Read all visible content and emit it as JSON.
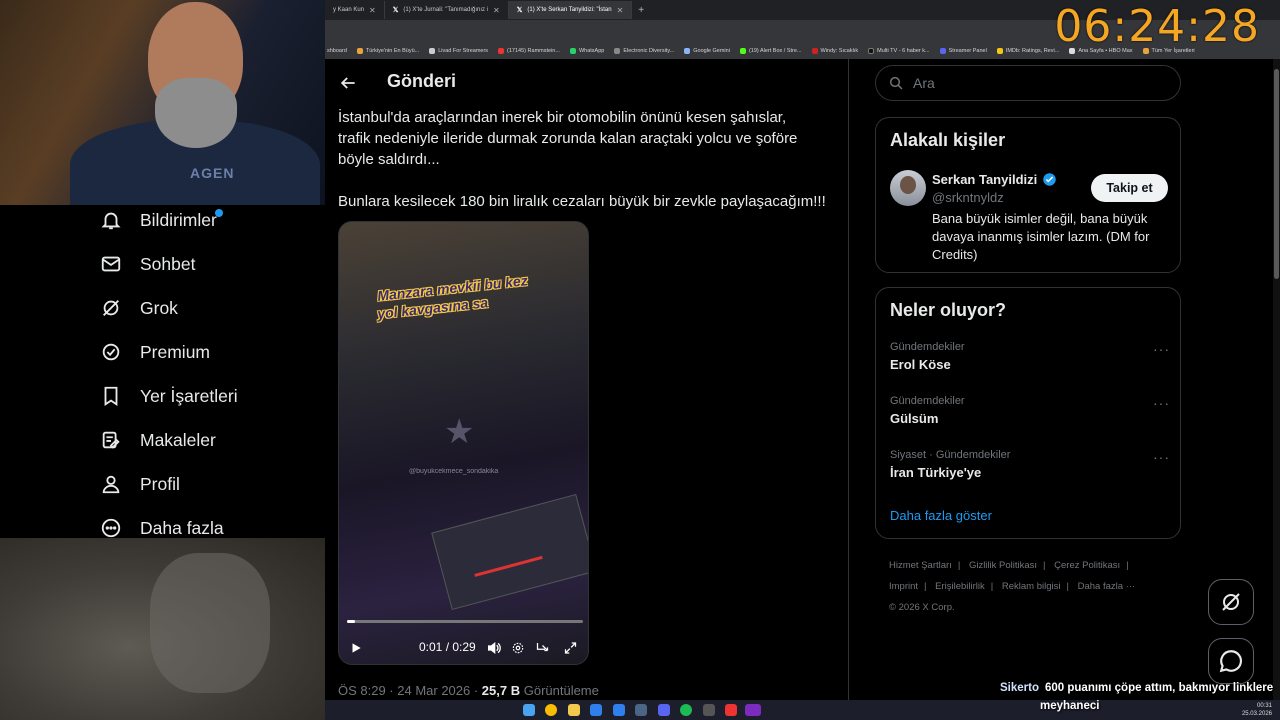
{
  "clock": "06:24:28",
  "browser": {
    "tabs": [
      {
        "label": "y Kaan Kun"
      },
      {
        "label": "(1) X'te Jurnali: \"Tanımadığınız i"
      },
      {
        "label": "(1) X'te Serkan Tanyildizi: \"İstan"
      }
    ],
    "bookmarks": [
      "shboard",
      "Türkiye'nin En Büyü...",
      "Livad For Streamers",
      "(17145) Rammstein...",
      "WhatsApp",
      "Electronic Diversity...",
      "Google Gemini",
      "(19) Alert Box / Stre...",
      "Windy: Sıcaklık",
      "Multi TV - 6 haber k...",
      "Streamer Panel",
      "IMDb: Ratings, Revi...",
      "Ana Sayfa • HBO Max",
      "Tüm Yer İşaretleri"
    ]
  },
  "nav": {
    "items": [
      {
        "label": "Bildirimler",
        "icon": "bell-icon"
      },
      {
        "label": "Sohbet",
        "icon": "mail-icon"
      },
      {
        "label": "Grok",
        "icon": "grok-icon"
      },
      {
        "label": "Premium",
        "icon": "premium-icon"
      },
      {
        "label": "Yer İşaretleri",
        "icon": "bookmark-icon"
      },
      {
        "label": "Makaleler",
        "icon": "article-icon"
      },
      {
        "label": "Profil",
        "icon": "profile-icon"
      },
      {
        "label": "Daha fazla",
        "icon": "more-icon"
      }
    ]
  },
  "webcam": {
    "shirt_text": "AGEN"
  },
  "post": {
    "header": "Gönderi",
    "lines": [
      "İstanbul'da araçlarından inerek bir otomobilin önünü kesen şahıslar,",
      "trafik nedeniyle ileride durmak zorunda kalan araçtaki yolcu ve şoföre",
      "böyle saldırdı...",
      "Bunlara kesilecek 180 bin liralık cezaları büyük bir zevkle paylaşacağım!!!"
    ],
    "video": {
      "caption1": "Manzara mevkii bu kez",
      "caption2": "yol kavgasına sa",
      "watermark": "@buyukcekmece_sondakika",
      "time": "0:01 / 0:29",
      "progress": 0.034
    },
    "meta_time": "ÖS 8:29 · 24 Mar 2026 · ",
    "views": "25,7 B",
    "views_label": " Görüntüleme"
  },
  "sidebar": {
    "search_placeholder": "Ara",
    "related": {
      "title": "Alakalı kişiler",
      "name": "Serkan Tanyildizi",
      "handle": "@srkntnyldz",
      "follow": "Takip et",
      "bio": "Bana büyük isimler değil, bana büyük davaya inanmış isimler lazım. (DM for Credits)"
    },
    "trends": {
      "title": "Neler oluyor?",
      "items": [
        {
          "category": "Gündemdekiler",
          "topic": "Erol Köse"
        },
        {
          "category": "Gündemdekiler",
          "topic": "Gülsüm"
        },
        {
          "category": "Siyaset · Gündemdekiler",
          "topic": "İran Türkiye'ye"
        }
      ],
      "more": "Daha fazla göster"
    },
    "footer": [
      "Hizmet Şartları",
      "|",
      "Gizlilik Politikası",
      "|",
      "Çerez Politikası",
      "|",
      "Imprint",
      "|",
      "Erişilebilirlik",
      "|",
      "Reklam bilgisi",
      "|",
      "Daha fazla ···",
      "© 2026 X Corp."
    ]
  },
  "chat": {
    "user": "Sikerto",
    "message": "600 puanımı çöpe attım, bakmıyor linklere",
    "line2": "meyhaneci"
  },
  "taskbar": {
    "time": "00:31",
    "date": "25.03.2026"
  }
}
